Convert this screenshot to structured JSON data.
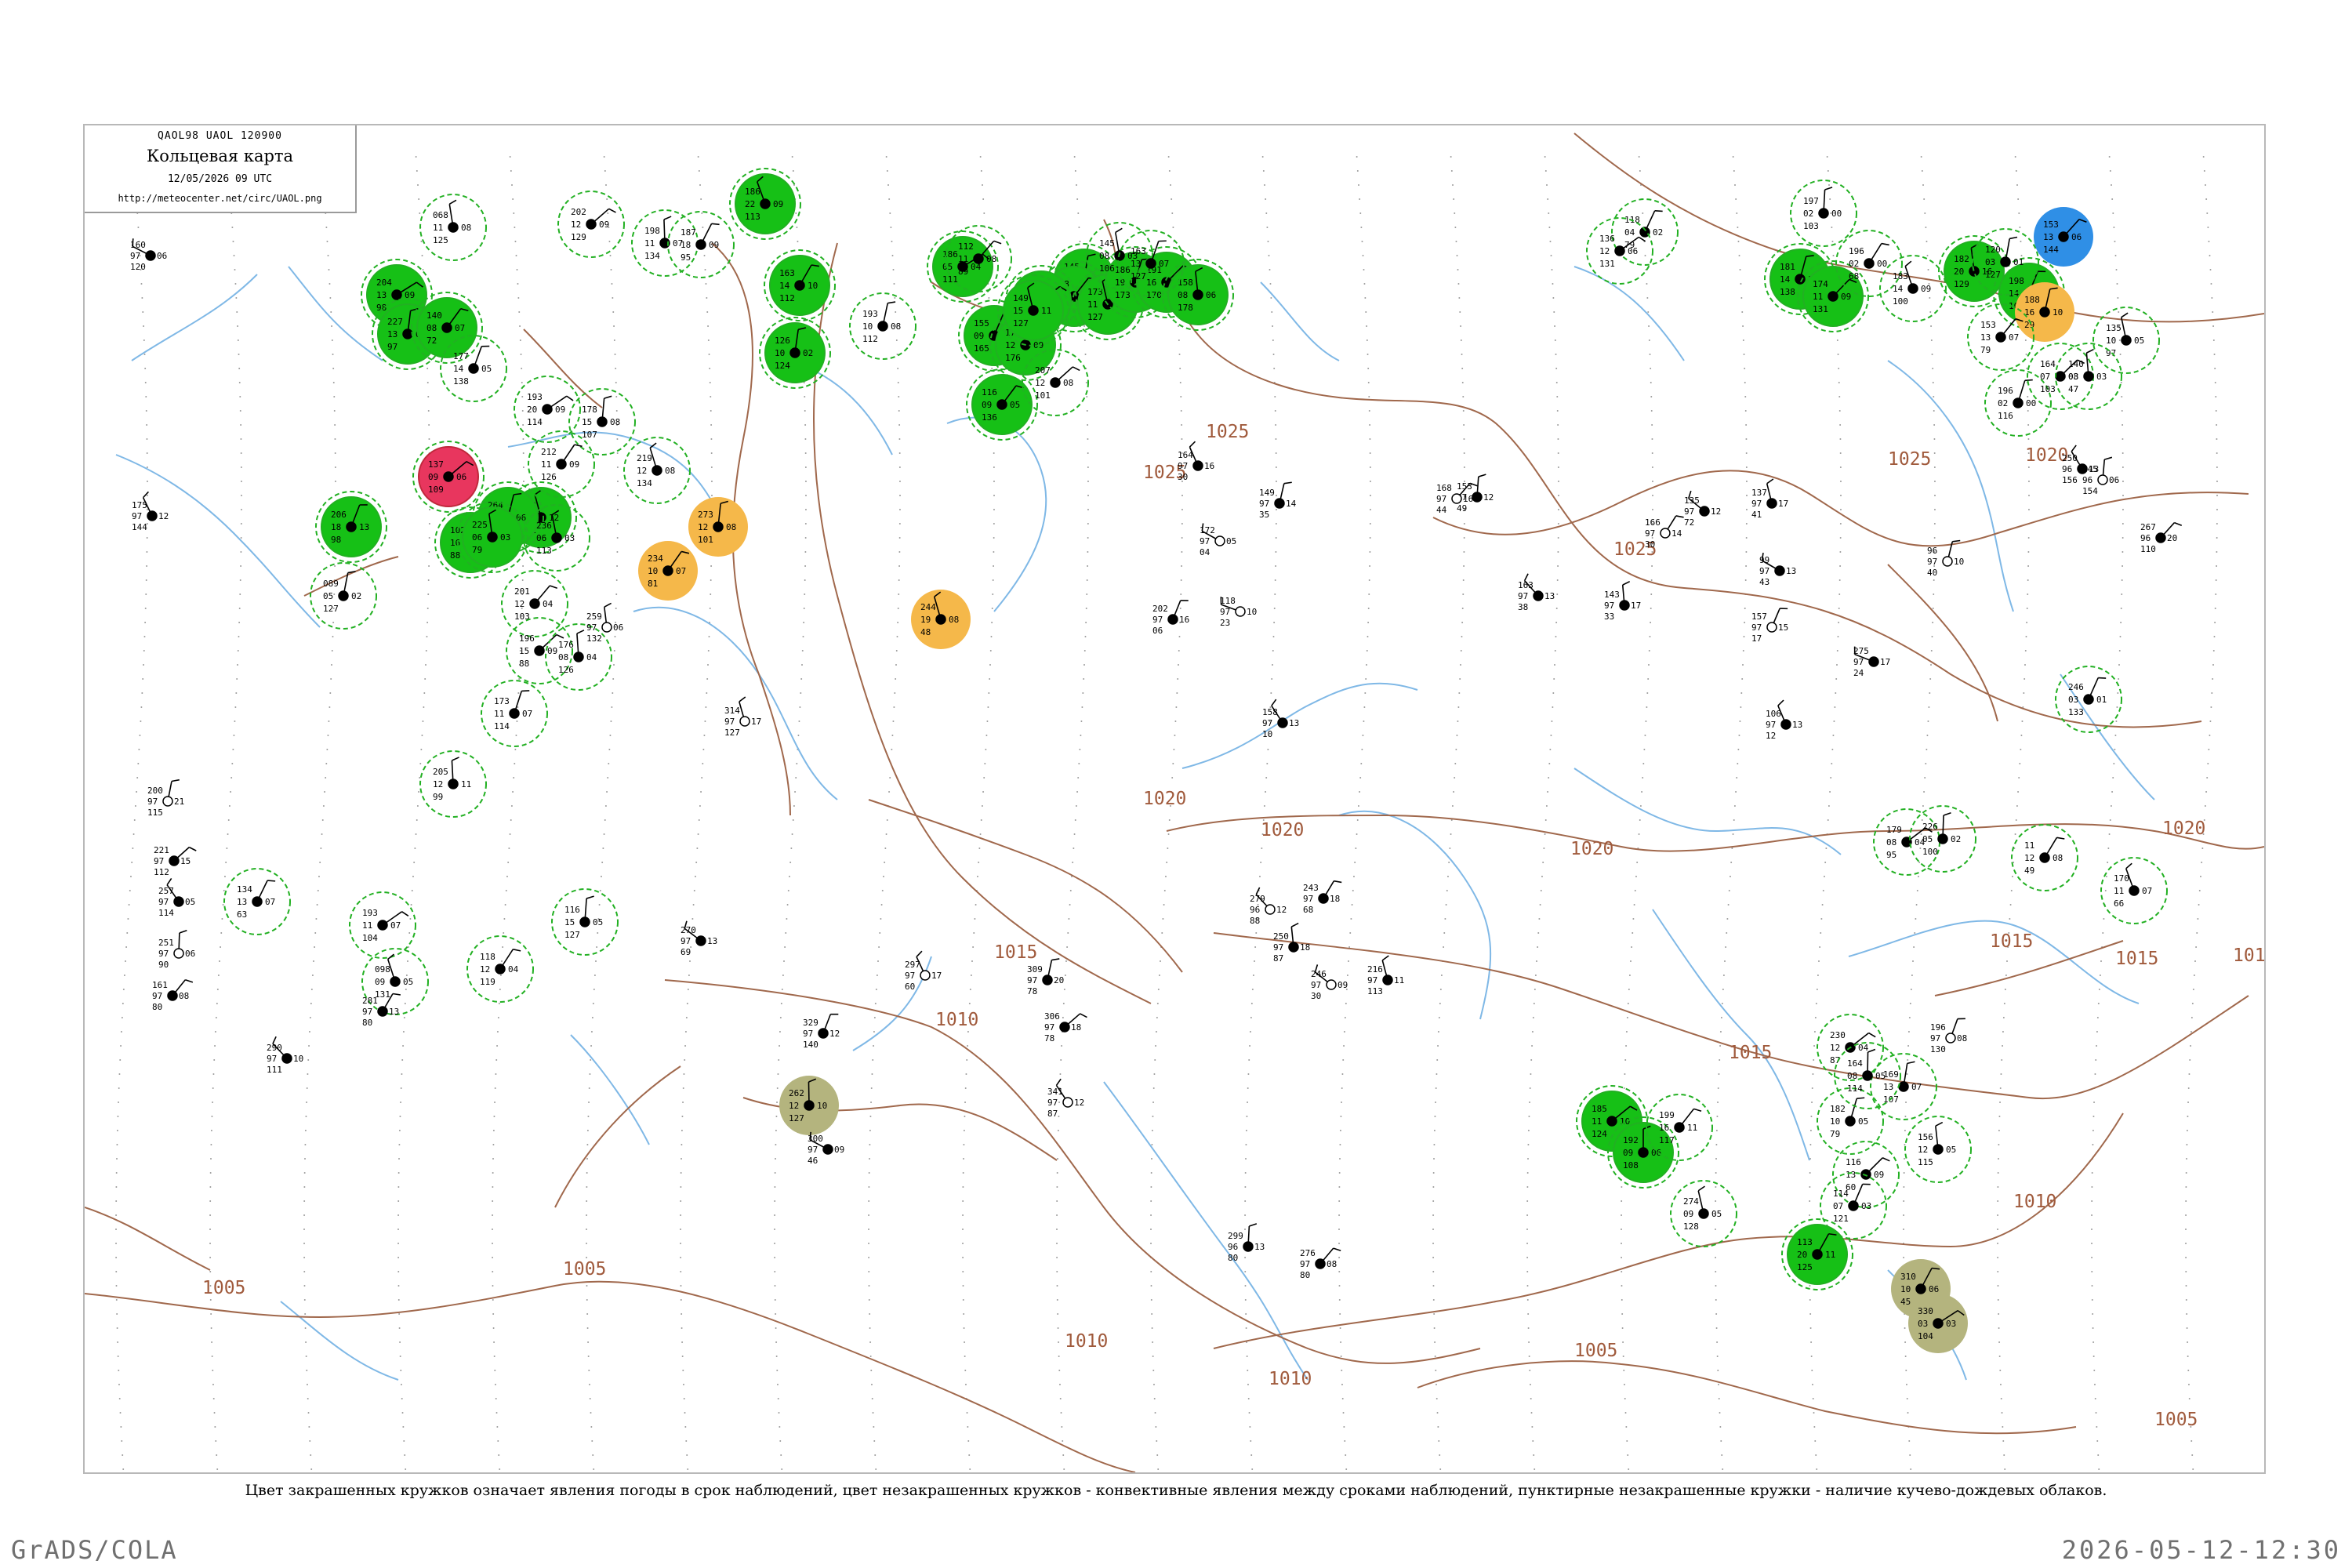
{
  "header": {
    "codes": "QAOL98  UAOL  120900",
    "title": "Кольцевая карта",
    "datetime": "12/05/2026 09 UTC",
    "url": "http://meteocenter.net/circ/UAOL.png"
  },
  "caption": "Цвет закрашенных кружков означает явления погоды в срок наблюдений, цвет незакрашенных кружков - конвективные явления между сроками наблюдений, пунктирные незакрашенные кружки - наличие кучево-дождевых облаков.",
  "footer": {
    "left": "GrADS/COLA",
    "right": "2026-05-12-12:30"
  },
  "colors": {
    "isobar": "#a0684c",
    "river": "#7fb8e6",
    "rain_fill": "#16c016",
    "cb_dash": "#22b022",
    "thunder_fill": "#e8365e",
    "fog_fill": "#b4b47e",
    "haze_fill": "#f5b84a",
    "shower_fill": "#2f8fe6"
  },
  "isobar_labels": [
    "1025",
    "1025",
    "1025",
    "1025",
    "1020",
    "1020",
    "1020",
    "1020",
    "1020",
    "1015",
    "1015",
    "1015",
    "1015",
    "1010",
    "1010",
    "1010",
    "1010",
    "1010",
    "1005",
    "1005",
    "1005",
    "1005"
  ],
  "stations": [
    {
      "kind": "rain",
      "p": "186",
      "t": "22",
      "td": "09",
      "pt": "113"
    },
    {
      "kind": "rain",
      "p": "145",
      "t": "12",
      "td": "11",
      "pt": "148"
    },
    {
      "kind": "rain",
      "p": "168",
      "t": "08",
      "td": "05",
      "pt": "152"
    },
    {
      "kind": "rain",
      "p": "173",
      "t": "11",
      "td": "07",
      "pt": "127"
    },
    {
      "kind": "rain",
      "p": "186",
      "t": "19",
      "td": "10",
      "pt": "173"
    },
    {
      "kind": "rain",
      "p": "191",
      "t": "16",
      "td": "12",
      "pt": "170"
    },
    {
      "kind": "rain",
      "p": "158",
      "t": "08",
      "td": "06",
      "pt": "178"
    },
    {
      "kind": "rain",
      "p": "155",
      "t": "09",
      "td": "07",
      "pt": "165"
    },
    {
      "kind": "rain",
      "p": "169",
      "t": "13",
      "td": "08",
      "pt": "130"
    },
    {
      "kind": "rain",
      "p": "171",
      "t": "12",
      "td": "09",
      "pt": "176"
    },
    {
      "kind": "rain",
      "p": "163",
      "t": "14",
      "td": "10",
      "pt": "112"
    },
    {
      "kind": "rain",
      "p": "186",
      "t": "05",
      "td": "04",
      "pt": "111"
    },
    {
      "kind": "rain",
      "p": "126",
      "t": "10",
      "td": "02",
      "pt": "124"
    },
    {
      "kind": "rain",
      "p": "116",
      "t": "09",
      "td": "05",
      "pt": "136"
    },
    {
      "kind": "rain",
      "p": "149",
      "t": "15",
      "td": "11",
      "pt": "127"
    },
    {
      "kind": "rain",
      "p": "181",
      "t": "14",
      "td": "11",
      "pt": "138"
    },
    {
      "kind": "rain",
      "p": "174",
      "t": "11",
      "td": "09",
      "pt": "131"
    },
    {
      "kind": "rain",
      "p": "182",
      "t": "20",
      "td": "16",
      "pt": "129"
    },
    {
      "kind": "rain",
      "p": "198",
      "t": "14",
      "td": "10",
      "pt": "108"
    },
    {
      "kind": "rain",
      "p": "185",
      "t": "11",
      "td": "10",
      "pt": "124"
    },
    {
      "kind": "rain",
      "p": "192",
      "t": "09",
      "td": "06",
      "pt": "108"
    },
    {
      "kind": "rain",
      "p": "113",
      "t": "20",
      "td": "11",
      "pt": "125"
    },
    {
      "kind": "rain",
      "p": "204",
      "t": "13",
      "td": "09",
      "pt": "98"
    },
    {
      "kind": "rain",
      "p": "227",
      "t": "13",
      "td": "08",
      "pt": "97"
    },
    {
      "kind": "rain",
      "p": "140",
      "t": "08",
      "td": "07",
      "pt": "72"
    },
    {
      "kind": "rain",
      "p": "163",
      "t": "22",
      "td": "12",
      "pt": "111"
    },
    {
      "kind": "rain",
      "p": "264",
      "t": "11",
      "td": "06",
      "pt": "59"
    },
    {
      "kind": "rain",
      "p": "102",
      "t": "16",
      "td": "07",
      "pt": "88"
    },
    {
      "kind": "rain",
      "p": "225",
      "t": "06",
      "td": "03",
      "pt": "79"
    },
    {
      "kind": "rain",
      "p": "206",
      "t": "18",
      "td": "13",
      "pt": "98"
    },
    {
      "kind": "thunder",
      "p": "137",
      "t": "09",
      "td": "06",
      "pt": "109"
    },
    {
      "kind": "fog",
      "p": "262",
      "t": "12",
      "td": "10",
      "pt": "127"
    },
    {
      "kind": "fog",
      "p": "310",
      "t": "10",
      "td": "06",
      "pt": "45"
    },
    {
      "kind": "fog",
      "p": "330",
      "t": "03",
      "td": "03",
      "pt": "104"
    },
    {
      "kind": "haze",
      "p": "273",
      "t": "12",
      "td": "08",
      "pt": "101"
    },
    {
      "kind": "haze",
      "p": "234",
      "t": "10",
      "td": "07",
      "pt": "81"
    },
    {
      "kind": "haze",
      "p": "244",
      "t": "19",
      "td": "08",
      "pt": "48"
    },
    {
      "kind": "haze",
      "p": "188",
      "t": "16",
      "td": "10",
      "pt": "29"
    },
    {
      "kind": "shower",
      "p": "153",
      "t": "13",
      "td": "06",
      "pt": "144"
    },
    {
      "kind": "cb",
      "p": "068",
      "t": "11",
      "td": "08",
      "pt": "125"
    },
    {
      "kind": "cb",
      "p": "177",
      "t": "14",
      "td": "05",
      "pt": "138"
    },
    {
      "kind": "cb",
      "p": "202",
      "t": "12",
      "td": "09",
      "pt": "129"
    },
    {
      "kind": "cb",
      "p": "198",
      "t": "11",
      "td": "07",
      "pt": "134"
    },
    {
      "kind": "cb",
      "p": "187",
      "t": "18",
      "td": "09",
      "pt": "95"
    },
    {
      "kind": "cb",
      "p": "193",
      "t": "20",
      "td": "09",
      "pt": "114"
    },
    {
      "kind": "cb",
      "p": "178",
      "t": "15",
      "td": "08",
      "pt": "107"
    },
    {
      "kind": "cb",
      "p": "212",
      "t": "11",
      "td": "09",
      "pt": "126"
    },
    {
      "kind": "cb",
      "p": "219",
      "t": "12",
      "td": "08",
      "pt": "134"
    },
    {
      "kind": "cb",
      "p": "193",
      "t": "10",
      "td": "08",
      "pt": "112"
    },
    {
      "kind": "cb",
      "p": "112",
      "t": "11",
      "td": "08",
      "pt": "89"
    },
    {
      "kind": "cb",
      "p": "145",
      "t": "08",
      "td": "03",
      "pt": "106"
    },
    {
      "kind": "cb",
      "p": "163",
      "t": "13",
      "td": "07",
      "pt": "127"
    },
    {
      "kind": "cb",
      "p": "207",
      "t": "12",
      "td": "08",
      "pt": "101"
    },
    {
      "kind": "cb",
      "p": "205",
      "t": "12",
      "td": "11",
      "pt": "99"
    },
    {
      "kind": "cb",
      "p": "134",
      "t": "13",
      "td": "07",
      "pt": "63"
    },
    {
      "kind": "cb",
      "p": "193",
      "t": "11",
      "td": "07",
      "pt": "104"
    },
    {
      "kind": "cb",
      "p": "116",
      "t": "15",
      "td": "05",
      "pt": "127"
    },
    {
      "kind": "cb",
      "p": "118",
      "t": "12",
      "td": "04",
      "pt": "119"
    },
    {
      "kind": "cb",
      "p": "098",
      "t": "09",
      "td": "05",
      "pt": "131"
    },
    {
      "kind": "cb",
      "p": "089",
      "t": "05",
      "td": "02",
      "pt": "127"
    },
    {
      "kind": "cb",
      "p": "201",
      "t": "12",
      "td": "04",
      "pt": "103"
    },
    {
      "kind": "cb",
      "p": "236",
      "t": "06",
      "td": "03",
      "pt": "113"
    },
    {
      "kind": "cb",
      "p": "173",
      "t": "11",
      "td": "07",
      "pt": "114"
    },
    {
      "kind": "cb",
      "p": "196",
      "t": "15",
      "td": "09",
      "pt": "88"
    },
    {
      "kind": "cb",
      "p": "176",
      "t": "08",
      "td": "04",
      "pt": "126"
    },
    {
      "kind": "cb",
      "p": "118",
      "t": "04",
      "td": "02",
      "pt": "79"
    },
    {
      "kind": "cb",
      "p": "136",
      "t": "12",
      "td": "06",
      "pt": "131"
    },
    {
      "kind": "cb",
      "p": "197",
      "t": "02",
      "td": "00",
      "pt": "103"
    },
    {
      "kind": "cb",
      "p": "196",
      "t": "02",
      "td": "00",
      "pt": "68"
    },
    {
      "kind": "cb",
      "p": "183",
      "t": "14",
      "td": "09",
      "pt": "100"
    },
    {
      "kind": "cb",
      "p": "120",
      "t": "03",
      "td": "01",
      "pt": "127"
    },
    {
      "kind": "cb",
      "p": "153",
      "t": "13",
      "td": "07",
      "pt": "79"
    },
    {
      "kind": "cb",
      "p": "135",
      "t": "10",
      "td": "05",
      "pt": "97"
    },
    {
      "kind": "cb",
      "p": "196",
      "t": "02",
      "td": "00",
      "pt": "116"
    },
    {
      "kind": "cb",
      "p": "164",
      "t": "07",
      "td": "03",
      "pt": "103"
    },
    {
      "kind": "cb",
      "p": "140",
      "t": "08",
      "td": "03",
      "pt": "47"
    },
    {
      "kind": "cb",
      "p": "246",
      "t": "03",
      "td": "01",
      "pt": "133"
    },
    {
      "kind": "cb",
      "p": "179",
      "t": "08",
      "td": "04",
      "pt": "95"
    },
    {
      "kind": "cb",
      "p": "226",
      "t": "05",
      "td": "02",
      "pt": "100"
    },
    {
      "kind": "cb",
      "p": "11",
      "t": "12",
      "td": "08",
      "pt": "49"
    },
    {
      "kind": "cb",
      "p": "170",
      "t": "11",
      "td": "07",
      "pt": "66"
    },
    {
      "kind": "cb",
      "p": "169",
      "t": "13",
      "td": "07",
      "pt": "107"
    },
    {
      "kind": "cb",
      "p": "199",
      "t": "16",
      "td": "11",
      "pt": "117"
    },
    {
      "kind": "cb",
      "p": "274",
      "t": "09",
      "td": "05",
      "pt": "128"
    },
    {
      "kind": "cb",
      "p": "182",
      "t": "10",
      "td": "05",
      "pt": "79"
    },
    {
      "kind": "cb",
      "p": "116",
      "t": "13",
      "td": "09",
      "pt": "60"
    },
    {
      "kind": "cb",
      "p": "156",
      "t": "12",
      "td": "05",
      "pt": "115"
    },
    {
      "kind": "cb",
      "p": "114",
      "t": "07",
      "td": "03",
      "pt": "121"
    },
    {
      "kind": "cb",
      "p": "230",
      "t": "12",
      "td": "04",
      "pt": "87"
    },
    {
      "kind": "cb",
      "p": "164",
      "t": "08",
      "td": "05",
      "pt": "114"
    },
    {
      "kind": "plain",
      "p": "196",
      "t": "97",
      "td": "08",
      "pt": "130"
    },
    {
      "kind": "plain",
      "p": "160",
      "t": "97",
      "td": "06",
      "pt": "120"
    },
    {
      "kind": "plain",
      "p": "175",
      "t": "97",
      "td": "12",
      "pt": "144"
    },
    {
      "kind": "plain",
      "p": "200",
      "t": "97",
      "td": "21",
      "pt": "115"
    },
    {
      "kind": "plain",
      "p": "221",
      "t": "97",
      "td": "15",
      "pt": "112"
    },
    {
      "kind": "plain",
      "p": "257",
      "t": "97",
      "td": "05",
      "pt": "114"
    },
    {
      "kind": "plain",
      "p": "251",
      "t": "97",
      "td": "06",
      "pt": "90"
    },
    {
      "kind": "plain",
      "p": "161",
      "t": "97",
      "td": "08",
      "pt": "80"
    },
    {
      "kind": "plain",
      "p": "290",
      "t": "97",
      "td": "10",
      "pt": "111"
    },
    {
      "kind": "plain",
      "p": "259",
      "t": "97",
      "td": "06",
      "pt": "132"
    },
    {
      "kind": "plain",
      "p": "281",
      "t": "97",
      "td": "13",
      "pt": "80"
    },
    {
      "kind": "plain",
      "p": "270",
      "t": "97",
      "td": "13",
      "pt": "69"
    },
    {
      "kind": "plain",
      "p": "314",
      "t": "97",
      "td": "17",
      "pt": "127"
    },
    {
      "kind": "plain",
      "p": "329",
      "t": "97",
      "td": "12",
      "pt": "140"
    },
    {
      "kind": "plain",
      "p": "300",
      "t": "97",
      "td": "09",
      "pt": "46"
    },
    {
      "kind": "plain",
      "p": "297",
      "t": "97",
      "td": "17",
      "pt": "60"
    },
    {
      "kind": "plain",
      "p": "309",
      "t": "97",
      "td": "20",
      "pt": "78"
    },
    {
      "kind": "plain",
      "p": "306",
      "t": "97",
      "td": "18",
      "pt": "78"
    },
    {
      "kind": "plain",
      "p": "341",
      "t": "97",
      "td": "12",
      "pt": "87"
    },
    {
      "kind": "plain",
      "p": "299",
      "t": "96",
      "td": "13",
      "pt": "80"
    },
    {
      "kind": "plain",
      "p": "276",
      "t": "97",
      "td": "08",
      "pt": "80"
    },
    {
      "kind": "plain",
      "p": "279",
      "t": "96",
      "td": "12",
      "pt": "88"
    },
    {
      "kind": "plain",
      "p": "250",
      "t": "97",
      "td": "18",
      "pt": "87"
    },
    {
      "kind": "plain",
      "p": "243",
      "t": "97",
      "td": "18",
      "pt": "68"
    },
    {
      "kind": "plain",
      "p": "246",
      "t": "97",
      "td": "09",
      "pt": "30"
    },
    {
      "kind": "plain",
      "p": "216",
      "t": "97",
      "td": "11",
      "pt": "113"
    },
    {
      "kind": "plain",
      "p": "202",
      "t": "97",
      "td": "16",
      "pt": "06"
    },
    {
      "kind": "plain",
      "p": "172",
      "t": "97",
      "td": "05",
      "pt": "04"
    },
    {
      "kind": "plain",
      "p": "164",
      "t": "97",
      "td": "16",
      "pt": "30"
    },
    {
      "kind": "plain",
      "p": "149",
      "t": "97",
      "td": "14",
      "pt": "35"
    },
    {
      "kind": "plain",
      "p": "118",
      "t": "97",
      "td": "10",
      "pt": "23"
    },
    {
      "kind": "plain",
      "p": "158",
      "t": "97",
      "td": "13",
      "pt": "10"
    },
    {
      "kind": "plain",
      "p": "153",
      "t": "97",
      "td": "12",
      "pt": "49"
    },
    {
      "kind": "plain",
      "p": "168",
      "t": "97",
      "td": "16",
      "pt": "44"
    },
    {
      "kind": "plain",
      "p": "163",
      "t": "97",
      "td": "13",
      "pt": "38"
    },
    {
      "kind": "plain",
      "p": "143",
      "t": "97",
      "td": "17",
      "pt": "33"
    },
    {
      "kind": "plain",
      "p": "166",
      "t": "97",
      "td": "14",
      "pt": "30"
    },
    {
      "kind": "plain",
      "p": "135",
      "t": "97",
      "td": "12",
      "pt": "72"
    },
    {
      "kind": "plain",
      "p": "137",
      "t": "97",
      "td": "17",
      "pt": "41"
    },
    {
      "kind": "plain",
      "p": "157",
      "t": "97",
      "td": "15",
      "pt": "17"
    },
    {
      "kind": "plain",
      "p": "99",
      "t": "97",
      "td": "13",
      "pt": "43"
    },
    {
      "kind": "plain",
      "p": "106",
      "t": "97",
      "td": "13",
      "pt": "12"
    },
    {
      "kind": "plain",
      "p": "96",
      "t": "97",
      "td": "10",
      "pt": "40"
    },
    {
      "kind": "plain",
      "p": "275",
      "t": "97",
      "td": "17",
      "pt": "24"
    },
    {
      "kind": "plain",
      "p": "250",
      "t": "96",
      "td": "13",
      "pt": "156"
    },
    {
      "kind": "plain",
      "p": "245",
      "t": "96",
      "td": "06",
      "pt": "154"
    },
    {
      "kind": "plain",
      "p": "267",
      "t": "96",
      "td": "20",
      "pt": "110"
    }
  ]
}
